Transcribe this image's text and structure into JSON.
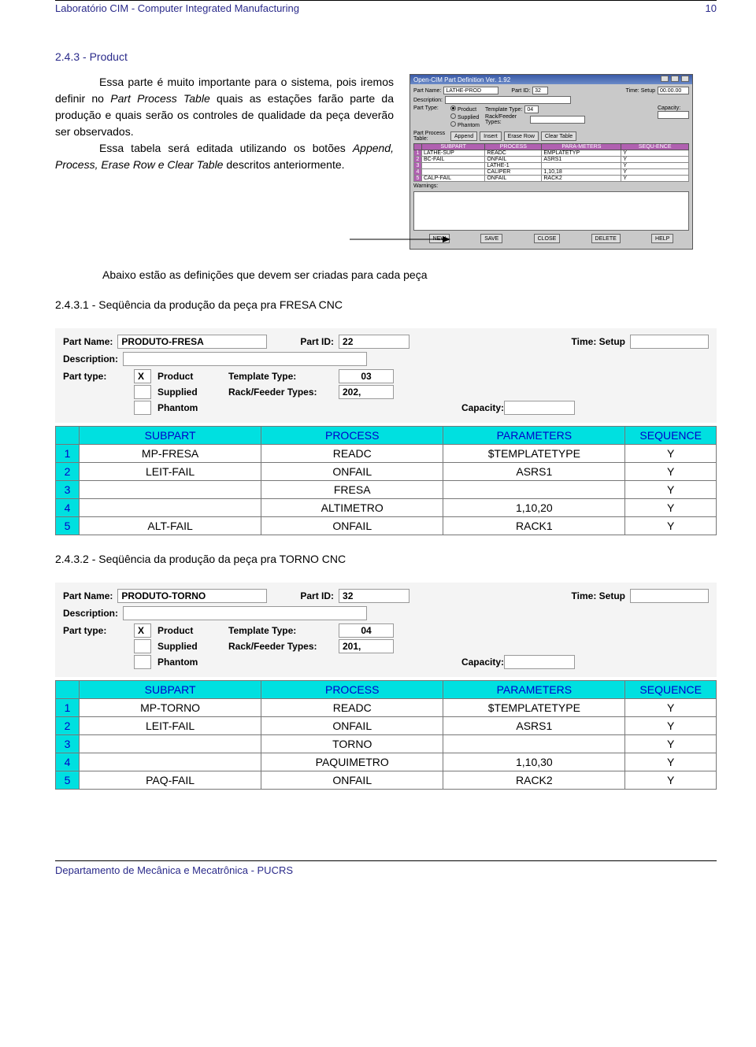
{
  "header": {
    "title": "Laboratório CIM - Computer Integrated Manufacturing",
    "page_num": "10"
  },
  "section": {
    "num_title": "2.4.3 - Product",
    "para1_a": "Essa parte é muito importante para o sistema, pois iremos definir no ",
    "para1_i1": "Part Process Table",
    "para1_b": " quais as estações farão parte da produção e quais serão os controles de qualidade da peça deverão ser observados.",
    "para2_a": "Essa tabela será editada utilizando os botões ",
    "para2_i1": "Append, Process, Erase Row e Clear Table",
    "para2_b": " descritos anteriormente.",
    "sub_statement": "Abaixo estão as definições que devem ser criadas para cada peça"
  },
  "app": {
    "title": "Open-CIM   Part Definition  Ver. 1.92",
    "part_name_lbl": "Part Name:",
    "part_name_val": "LATHE-PROD",
    "part_id_lbl": "Part ID:",
    "part_id_val": "32",
    "time_lbl": "Time:  Setup",
    "time_val": "00.00.00",
    "desc_lbl": "Description:",
    "part_type_lbl": "Part Type:",
    "pt_product": "Product",
    "pt_supplied": "Supplied",
    "pt_phantom": "Phantom",
    "tmpl_lbl": "Template Type:",
    "tmpl_val": "04",
    "rack_lbl": "Rack/Feeder Types:",
    "capacity_lbl": "Capacity:",
    "ppt_lbl": "Part Process Table:",
    "btn_append": "Append",
    "btn_insert": "Insert",
    "btn_erase": "Erase Row",
    "btn_clear": "Clear Table",
    "th_subpart": "SUBPART",
    "th_process": "PROCESS",
    "th_param": "PARA-METERS",
    "th_seq": "SEQU-ENCE",
    "rows": [
      {
        "n": "1",
        "s": "LATHE-SUP",
        "p": "READC",
        "pa": "EMPLATETYP",
        "q": "Y"
      },
      {
        "n": "2",
        "s": "BC-FAIL",
        "p": "ONFAIL",
        "pa": "ASRS1",
        "q": "Y"
      },
      {
        "n": "3",
        "s": "",
        "p": "LATHE-1",
        "pa": "",
        "q": "Y"
      },
      {
        "n": "4",
        "s": "",
        "p": "CALIPER",
        "pa": "1,10,18",
        "q": "Y"
      },
      {
        "n": "5",
        "s": "CALP-FAIL",
        "p": "ONFAIL",
        "pa": "RACK2",
        "q": "Y"
      }
    ],
    "warn_lbl": "Warnings:",
    "b_new": "NEW",
    "b_save": "SAVE",
    "b_close": "CLOSE",
    "b_delete": "DELETE",
    "b_help": "HELP"
  },
  "seq1": {
    "heading": "2.4.3.1 - Seqüência da produção da peça pra FRESA CNC",
    "labels": {
      "part_name": "Part Name:",
      "part_id": "Part ID:",
      "time": "Time: Setup",
      "description": "Description:",
      "part_type": "Part type:",
      "product": "Product",
      "supplied": "Supplied",
      "phantom": "Phantom",
      "template_type": "Template Type:",
      "rack_feeder": "Rack/Feeder Types:",
      "capacity": "Capacity:"
    },
    "values": {
      "part_name": "PRODUTO-FRESA",
      "part_id": "22",
      "x": "X",
      "template_type": "03",
      "rack_feeder": "202,"
    },
    "headers": {
      "subpart": "SUBPART",
      "process": "PROCESS",
      "parameters": "PARAMETERS",
      "sequence": "SEQUENCE"
    },
    "rows": [
      {
        "n": "1",
        "subpart": "MP-FRESA",
        "process": "READC",
        "params": "$TEMPLATETYPE",
        "seq": "Y"
      },
      {
        "n": "2",
        "subpart": "LEIT-FAIL",
        "process": "ONFAIL",
        "params": "ASRS1",
        "seq": "Y"
      },
      {
        "n": "3",
        "subpart": "",
        "process": "FRESA",
        "params": "",
        "seq": "Y"
      },
      {
        "n": "4",
        "subpart": "",
        "process": "ALTIMETRO",
        "params": "1,10,20",
        "seq": "Y"
      },
      {
        "n": "5",
        "subpart": "ALT-FAIL",
        "process": "ONFAIL",
        "params": "RACK1",
        "seq": "Y"
      }
    ]
  },
  "seq2": {
    "heading": "2.4.3.2 - Seqüência da produção da peça pra TORNO CNC",
    "labels": {
      "part_name": "Part Name:",
      "part_id": "Part ID:",
      "time": "Time: Setup",
      "description": "Description:",
      "part_type": "Part type:",
      "product": "Product",
      "supplied": "Supplied",
      "phantom": "Phantom",
      "template_type": "Template Type:",
      "rack_feeder": "Rack/Feeder Types:",
      "capacity": "Capacity:"
    },
    "values": {
      "part_name": "PRODUTO-TORNO",
      "part_id": "32",
      "x": "X",
      "template_type": "04",
      "rack_feeder": "201,"
    },
    "headers": {
      "subpart": "SUBPART",
      "process": "PROCESS",
      "parameters": "PARAMETERS",
      "sequence": "SEQUENCE"
    },
    "rows": [
      {
        "n": "1",
        "subpart": "MP-TORNO",
        "process": "READC",
        "params": "$TEMPLATETYPE",
        "seq": "Y"
      },
      {
        "n": "2",
        "subpart": "LEIT-FAIL",
        "process": "ONFAIL",
        "params": "ASRS1",
        "seq": "Y"
      },
      {
        "n": "3",
        "subpart": "",
        "process": "TORNO",
        "params": "",
        "seq": "Y"
      },
      {
        "n": "4",
        "subpart": "",
        "process": "PAQUIMETRO",
        "params": "1,10,30",
        "seq": "Y"
      },
      {
        "n": "5",
        "subpart": "PAQ-FAIL",
        "process": "ONFAIL",
        "params": "RACK2",
        "seq": "Y"
      }
    ]
  },
  "footer": {
    "text": "Departamento de Mecânica e Mecatrônica - PUCRS"
  }
}
